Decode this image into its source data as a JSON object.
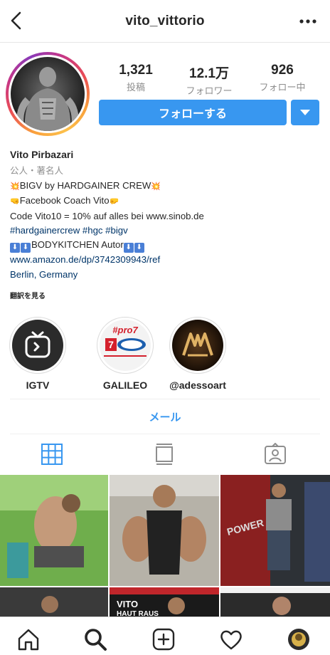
{
  "header": {
    "username": "vito_vittorio"
  },
  "stats": [
    {
      "value": "1,321",
      "label": "投稿"
    },
    {
      "value": "12.1万",
      "label": "フォロワー"
    },
    {
      "value": "926",
      "label": "フォロー中"
    }
  ],
  "actions": {
    "follow_label": "フォローする"
  },
  "bio": {
    "name": "Vito Pirbazari",
    "category": "公人・著名人",
    "line1": "BIGV by HARDGAINER CREW",
    "line2": "Facebook Coach Vito",
    "line3": "Code Vito10 = 10% auf alles bei www.sinob.de",
    "hashtags": "#hardgainercrew  #hgc #bigv",
    "line5": "BODYKITCHEN Autor",
    "link": "www.amazon.de/dp/3742309943/ref",
    "location": "Berlin, Germany",
    "arrow_glyph": "⬇"
  },
  "translate_label": "翻訳を見る",
  "highlights": [
    {
      "label": "IGTV"
    },
    {
      "label": "GALILEO",
      "logo_text": "#pro7"
    },
    {
      "label": "@adessoart"
    }
  ],
  "email_label": "メール",
  "grid_overlay_text": [
    "VITO",
    "HAUT RAUS"
  ],
  "colors": {
    "accent": "#3897f0",
    "link": "#003569",
    "muted": "#8e8e8e"
  },
  "icons": {
    "tabs": [
      "grid-icon",
      "feed-icon",
      "tagged-icon"
    ],
    "nav": [
      "home-icon",
      "search-icon",
      "add-post-icon",
      "heart-icon",
      "profile-avatar"
    ]
  }
}
